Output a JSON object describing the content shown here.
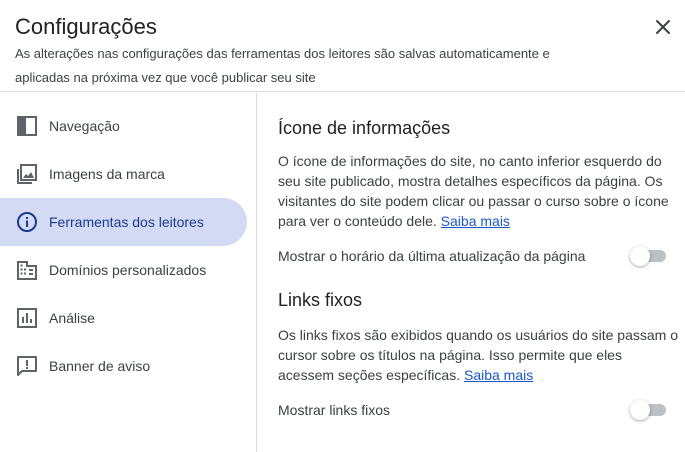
{
  "dialog": {
    "title": "Configurações",
    "subtitle": "As alterações nas configurações das ferramentas dos leitores são salvas automaticamente e aplicadas na próxima vez que você publicar seu site",
    "close_icon": "close-icon"
  },
  "sidebar": {
    "items": [
      {
        "label": "Navegação",
        "icon": "navigation-icon",
        "active": false
      },
      {
        "label": "Imagens da marca",
        "icon": "brand-images-icon",
        "active": false
      },
      {
        "label": "Ferramentas dos leitores",
        "icon": "info-icon",
        "active": true
      },
      {
        "label": "Domínios personalizados",
        "icon": "domain-icon",
        "active": false
      },
      {
        "label": "Análise",
        "icon": "analytics-icon",
        "active": false
      },
      {
        "label": "Banner de aviso",
        "icon": "announcement-icon",
        "active": false
      }
    ]
  },
  "main": {
    "info_section": {
      "title": "Ícone de informações",
      "description": "O ícone de informações do site, no canto inferior esquerdo do seu site publicado, mostra detalhes específicos da página. Os visitantes do site podem clicar ou passar o curso sobre o ícone para ver o conteúdo dele.",
      "link": "Saiba mais",
      "toggle_label": "Mostrar o horário da última atualização da página",
      "toggle_on": false
    },
    "anchor_section": {
      "title": "Links fixos",
      "description": "Os links fixos são exibidos quando os usuários do site passam o cursor sobre os títulos na página. Isso permite que eles acessem seções específicas.",
      "link": "Saiba mais",
      "toggle_label": "Mostrar links fixos",
      "toggle_on": false
    }
  },
  "colors": {
    "active_bg": "#d3daf3",
    "active_text": "#1a3a8f",
    "link": "#1a56c7",
    "toggle_track": "#bdc1c6"
  }
}
